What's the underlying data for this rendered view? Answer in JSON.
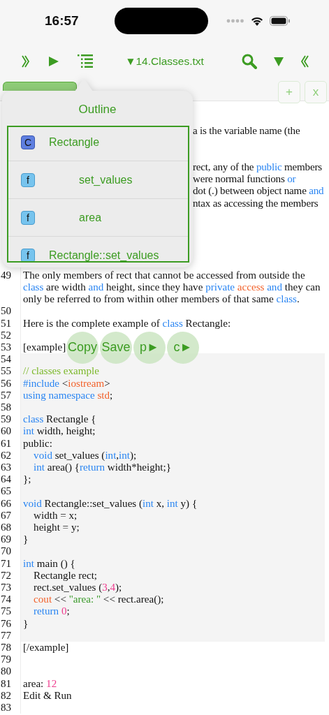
{
  "status_bar": {
    "time": "16:57"
  },
  "toolbar": {
    "file_title": "▼14.Classes.txt"
  },
  "tab_bar": {
    "tab_selected": true,
    "add": "+",
    "close": "x"
  },
  "outline": {
    "title": "Outline",
    "items": [
      {
        "kind": "class",
        "icon": "C",
        "label": "Rectangle",
        "children": [
          {
            "kind": "function",
            "icon": "f",
            "label": "set_values"
          },
          {
            "kind": "function",
            "icon": "f",
            "label": "area"
          }
        ]
      },
      {
        "kind": "function",
        "icon": "f",
        "label": "Rectangle::set_values"
      }
    ]
  },
  "covered_fragments": [
    {
      "segs": [
        {
          "t": "a is the variable name (the",
          "kind": "plain"
        }
      ]
    },
    {
      "segs": [
        {
          "t": "rect, any of the ",
          "kind": "plain"
        },
        {
          "t": "public",
          "kind": "kw"
        },
        {
          "t": " members",
          "kind": "plain"
        }
      ]
    },
    {
      "segs": [
        {
          "t": "were normal functions ",
          "kind": "plain"
        },
        {
          "t": "or",
          "kind": "kw"
        }
      ]
    },
    {
      "segs": [
        {
          "t": "dot (.) between object name ",
          "kind": "plain"
        },
        {
          "t": "and",
          "kind": "kw"
        }
      ]
    },
    {
      "segs": [
        {
          "t": "ntax as accessing the members",
          "kind": "plain"
        }
      ]
    }
  ],
  "lines": [
    {
      "n": "49",
      "kind": "text",
      "segs": [
        {
          "t": "The only members of rect that cannot be accessed from outside the ",
          "kind": "plain"
        },
        {
          "t": "class",
          "kind": "kw"
        },
        {
          "t": " are width ",
          "kind": "plain"
        },
        {
          "t": "and",
          "kind": "kw"
        },
        {
          "t": " height, since they have ",
          "kind": "plain"
        },
        {
          "t": "private ",
          "kind": "kw"
        },
        {
          "t": "access ",
          "kind": "lib"
        },
        {
          "t": "and",
          "kind": "kw"
        },
        {
          "t": " they can only be referred to from within other members of that same ",
          "kind": "plain"
        },
        {
          "t": "class",
          "kind": "kw"
        },
        {
          "t": ".",
          "kind": "plain"
        }
      ]
    },
    {
      "n": "50",
      "kind": "text"
    },
    {
      "n": "51",
      "kind": "text",
      "segs": [
        {
          "t": "Here is the complete example of ",
          "kind": "plain"
        },
        {
          "t": "class",
          "kind": "kw"
        },
        {
          "t": " Rectangle:",
          "kind": "plain"
        }
      ]
    },
    {
      "n": "52",
      "kind": "text"
    },
    {
      "n": "53",
      "kind": "text",
      "segs": [
        {
          "t": "[example]",
          "kind": "plain"
        }
      ],
      "actions": [
        "Copy",
        "Save",
        "p►",
        "c►"
      ]
    },
    {
      "n": "54",
      "kind": "code"
    },
    {
      "n": "55",
      "kind": "code",
      "segs": [
        {
          "t": "// classes example",
          "kind": "comment"
        }
      ]
    },
    {
      "n": "56",
      "kind": "code",
      "segs": [
        {
          "t": "#include",
          "kind": "kw"
        },
        {
          "t": " <",
          "kind": "plain"
        },
        {
          "t": "iostream",
          "kind": "lib"
        },
        {
          "t": ">",
          "kind": "plain"
        }
      ]
    },
    {
      "n": "57",
      "kind": "code",
      "segs": [
        {
          "t": "using namespace",
          "kind": "kw"
        },
        {
          "t": " std",
          "kind": "lib"
        },
        {
          "t": ";",
          "kind": "plain"
        }
      ]
    },
    {
      "n": "58",
      "kind": "code"
    },
    {
      "n": "59",
      "kind": "code",
      "segs": [
        {
          "t": "class",
          "kind": "kw"
        },
        {
          "t": " Rectangle {",
          "kind": "plain"
        }
      ]
    },
    {
      "n": "60",
      "kind": "code",
      "segs": [
        {
          "t": "int",
          "kind": "kw"
        },
        {
          "t": " width, height;",
          "kind": "plain"
        }
      ]
    },
    {
      "n": "61",
      "kind": "code",
      "segs": [
        {
          "t": "public:",
          "kind": "plain"
        }
      ]
    },
    {
      "n": "62",
      "kind": "code",
      "segs": [
        {
          "t": "    void",
          "kind": "kw"
        },
        {
          "t": " set_values (",
          "kind": "plain"
        },
        {
          "t": "int",
          "kind": "kw"
        },
        {
          "t": ",",
          "kind": "plain"
        },
        {
          "t": "int",
          "kind": "kw"
        },
        {
          "t": ");",
          "kind": "plain"
        }
      ]
    },
    {
      "n": "63",
      "kind": "code",
      "segs": [
        {
          "t": "    int",
          "kind": "kw"
        },
        {
          "t": " area() {",
          "kind": "plain"
        },
        {
          "t": "return",
          "kind": "kw"
        },
        {
          "t": " width*height;}",
          "kind": "plain"
        }
      ]
    },
    {
      "n": "64",
      "kind": "code",
      "segs": [
        {
          "t": "};",
          "kind": "plain"
        }
      ]
    },
    {
      "n": "65",
      "kind": "code"
    },
    {
      "n": "66",
      "kind": "code",
      "segs": [
        {
          "t": "void",
          "kind": "kw"
        },
        {
          "t": " Rectangle::set_values (",
          "kind": "plain"
        },
        {
          "t": "int",
          "kind": "kw"
        },
        {
          "t": " x, ",
          "kind": "plain"
        },
        {
          "t": "int",
          "kind": "kw"
        },
        {
          "t": " y) {",
          "kind": "plain"
        }
      ]
    },
    {
      "n": "67",
      "kind": "code",
      "segs": [
        {
          "t": "    width = x;",
          "kind": "plain"
        }
      ]
    },
    {
      "n": "68",
      "kind": "code",
      "segs": [
        {
          "t": "    height = y;",
          "kind": "plain"
        }
      ]
    },
    {
      "n": "69",
      "kind": "code",
      "segs": [
        {
          "t": "}",
          "kind": "plain"
        }
      ]
    },
    {
      "n": "70",
      "kind": "code"
    },
    {
      "n": "71",
      "kind": "code",
      "segs": [
        {
          "t": "int",
          "kind": "kw"
        },
        {
          "t": " main () {",
          "kind": "plain"
        }
      ]
    },
    {
      "n": "72",
      "kind": "code",
      "segs": [
        {
          "t": "    Rectangle rect;",
          "kind": "plain"
        }
      ]
    },
    {
      "n": "73",
      "kind": "code",
      "segs": [
        {
          "t": "    rect.set_values (",
          "kind": "plain"
        },
        {
          "t": "3",
          "kind": "num"
        },
        {
          "t": ",",
          "kind": "plain"
        },
        {
          "t": "4",
          "kind": "num"
        },
        {
          "t": ");",
          "kind": "plain"
        }
      ]
    },
    {
      "n": "74",
      "kind": "code",
      "segs": [
        {
          "t": "    cout",
          "kind": "lib"
        },
        {
          "t": " << ",
          "kind": "plain"
        },
        {
          "t": "\"area: \"",
          "kind": "str"
        },
        {
          "t": " << rect.area();",
          "kind": "plain"
        }
      ]
    },
    {
      "n": "75",
      "kind": "code",
      "segs": [
        {
          "t": "    return",
          "kind": "kw"
        },
        {
          "t": " 0",
          "kind": "num"
        },
        {
          "t": ";",
          "kind": "plain"
        }
      ]
    },
    {
      "n": "76",
      "kind": "code",
      "segs": [
        {
          "t": "}",
          "kind": "plain"
        }
      ]
    },
    {
      "n": "77",
      "kind": "code"
    },
    {
      "n": "78",
      "kind": "text",
      "segs": [
        {
          "t": "[/example]",
          "kind": "plain"
        }
      ]
    },
    {
      "n": "79",
      "kind": "text"
    },
    {
      "n": "80",
      "kind": "text"
    },
    {
      "n": "81",
      "kind": "text",
      "segs": [
        {
          "t": "area: ",
          "kind": "plain"
        },
        {
          "t": "12",
          "kind": "num"
        }
      ]
    },
    {
      "n": "82",
      "kind": "text",
      "segs": [
        {
          "t": "Edit & Run",
          "kind": "plain"
        }
      ]
    },
    {
      "n": "83",
      "kind": "text"
    }
  ]
}
